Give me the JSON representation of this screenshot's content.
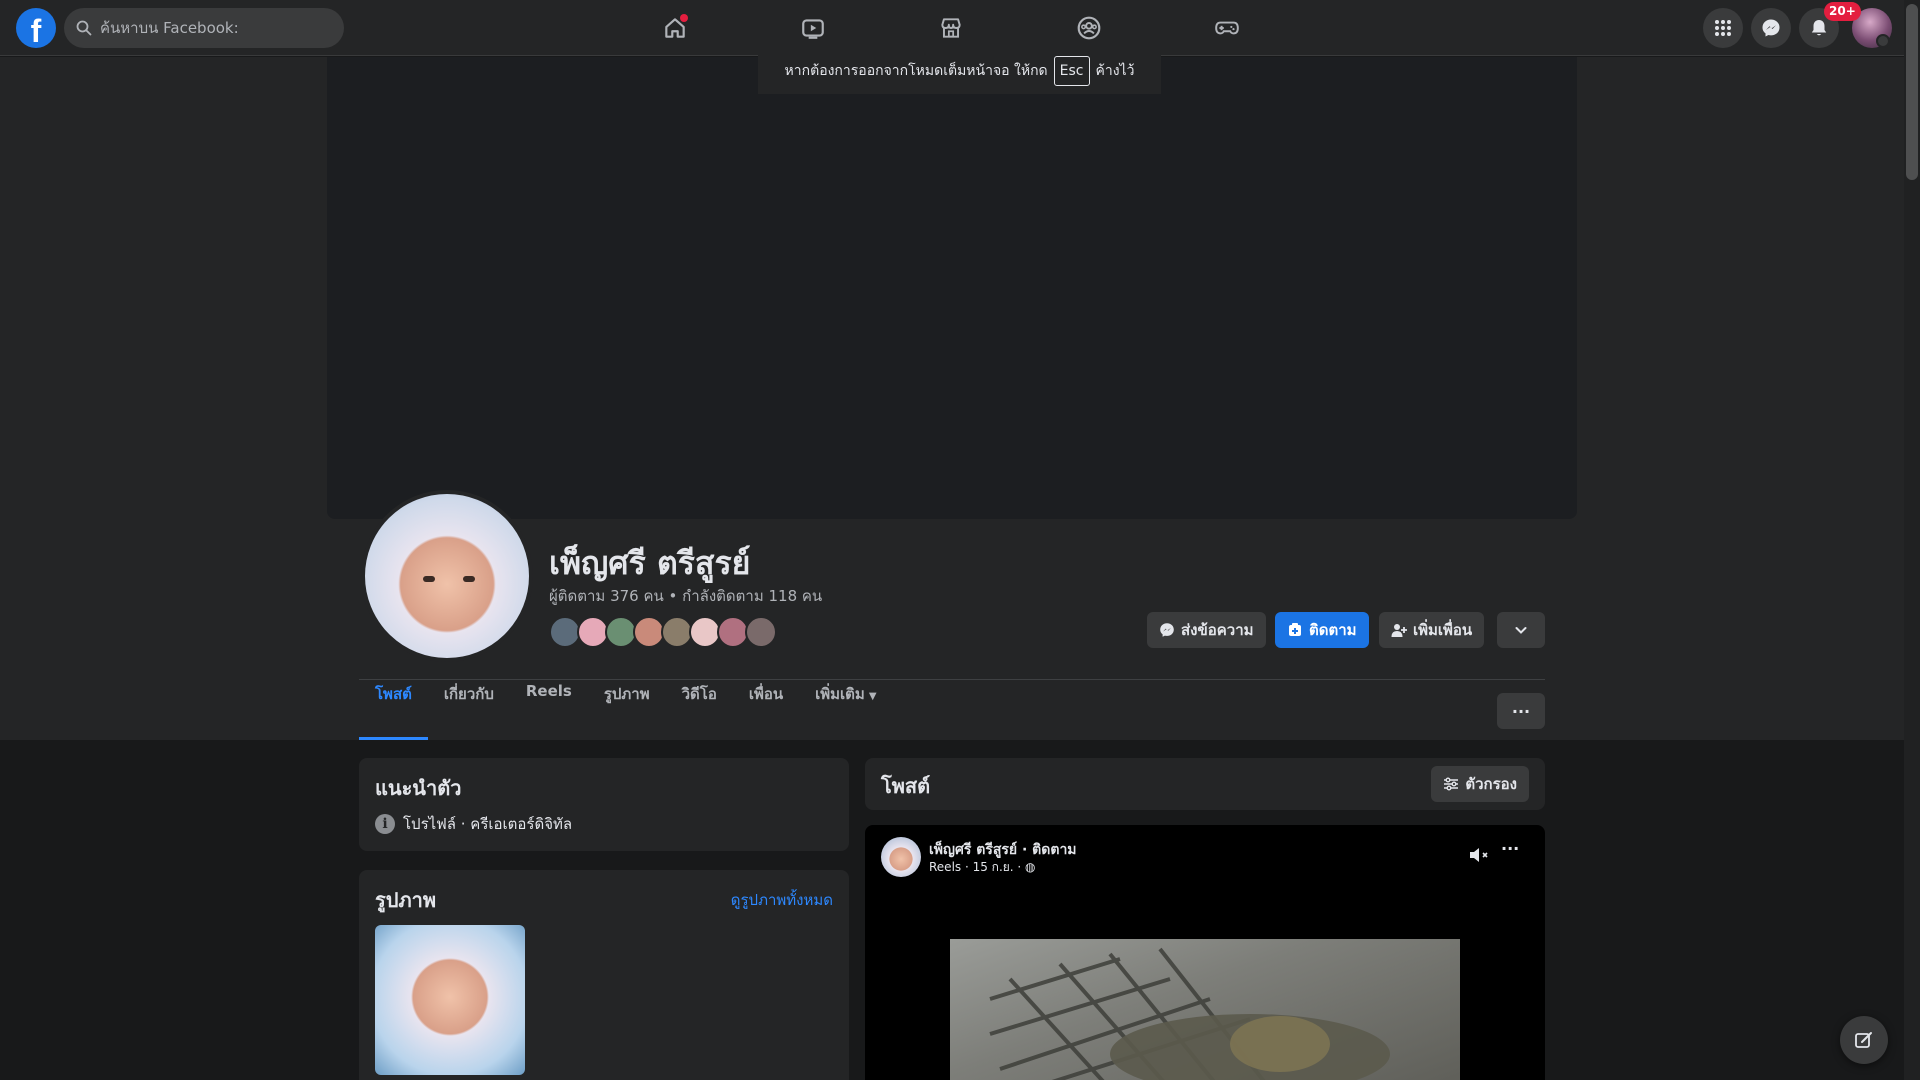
{
  "app": {
    "logo_letter": "f",
    "search_placeholder": "ค้นหาบน Facebook:"
  },
  "nav": {
    "icons": [
      "home-icon",
      "watch-icon",
      "marketplace-icon",
      "groups-icon",
      "gaming-icon"
    ],
    "home_has_dot": true
  },
  "topbar_right": {
    "icons": [
      "menu-grid-icon",
      "messenger-icon",
      "bell-icon"
    ],
    "notification_count": "20+"
  },
  "fullscreen_toast": {
    "prefix": "หากต้องการออกจากโหมดเต็มหน้าจอ ให้กด",
    "key": "Esc",
    "suffix": "ค้างไว้"
  },
  "profile": {
    "name": "เพ็ญศรี ตรีสูรย์",
    "followers_line": "ผู้ติดตาม 376 คน • กำลังติดตาม 118 คน",
    "friend_face_colors": [
      "#5b6b7a",
      "#e6a9b8",
      "#6a8f72",
      "#c98a7a",
      "#8a7d6a",
      "#e9c7c7",
      "#b07080",
      "#7a6a6a"
    ]
  },
  "actions": {
    "message": "ส่งข้อความ",
    "follow": "ติดตาม",
    "add_friend": "เพิ่มเพื่อน"
  },
  "tabs": [
    {
      "label": "โพสต์",
      "active": true
    },
    {
      "label": "เกี่ยวกับ",
      "active": false
    },
    {
      "label": "Reels",
      "active": false
    },
    {
      "label": "รูปภาพ",
      "active": false
    },
    {
      "label": "วิดีโอ",
      "active": false
    },
    {
      "label": "เพื่อน",
      "active": false
    },
    {
      "label": "เพิ่มเติม",
      "active": false
    }
  ],
  "intro": {
    "title": "แนะนำตัว",
    "profile_line": "โปรไฟล์ · ครีเอเตอร์ดิจิทัล"
  },
  "photos": {
    "title": "รูปภาพ",
    "see_all": "ดูรูปภาพทั้งหมด"
  },
  "posts": {
    "title": "โพสต์",
    "filter": "ตัวกรอง"
  },
  "post": {
    "author": "เพ็ญศรี ตรีสูรย์ · ติดตาม",
    "meta": "Reels · 15 ก.ย. · "
  },
  "colors": {
    "accent": "#2d88ff",
    "button_blue": "#1b74e4",
    "background": "#18191a",
    "surface": "#242526",
    "notification_red": "#e41e3f"
  }
}
